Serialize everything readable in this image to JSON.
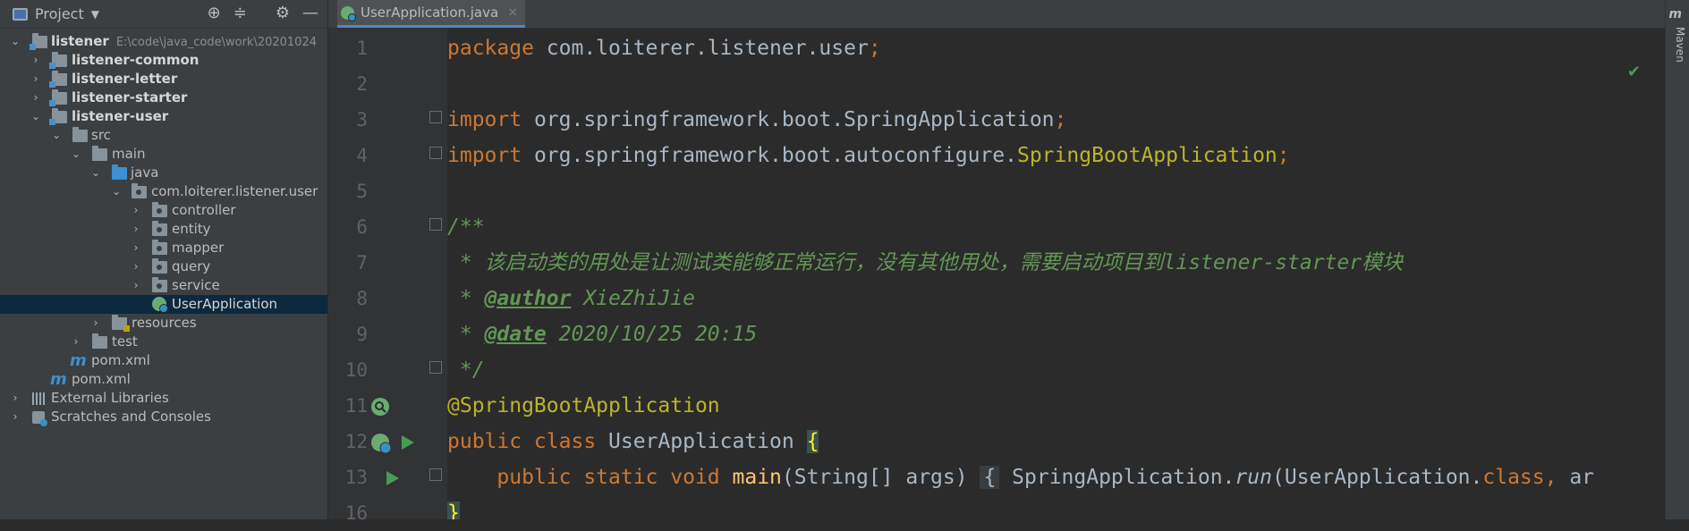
{
  "project_panel": {
    "title": "Project",
    "tree": [
      {
        "label": "listener",
        "path": "E:\\code\\java_code\\work\\20201024"
      },
      {
        "label": "listener-common"
      },
      {
        "label": "listener-letter"
      },
      {
        "label": "listener-starter"
      },
      {
        "label": "listener-user"
      },
      {
        "label": "src"
      },
      {
        "label": "main"
      },
      {
        "label": "java"
      },
      {
        "label": "com.loiterer.listener.user"
      },
      {
        "label": "controller"
      },
      {
        "label": "entity"
      },
      {
        "label": "mapper"
      },
      {
        "label": "query"
      },
      {
        "label": "service"
      },
      {
        "label": "UserApplication",
        "selected": true
      },
      {
        "label": "resources"
      },
      {
        "label": "test"
      },
      {
        "label": "pom.xml"
      },
      {
        "label": "pom.xml"
      },
      {
        "label": "External Libraries"
      },
      {
        "label": "Scratches and Consoles"
      }
    ]
  },
  "editor": {
    "tab_label": "UserApplication.java",
    "line_numbers": [
      "1",
      "2",
      "3",
      "4",
      "5",
      "6",
      "7",
      "8",
      "9",
      "10",
      "11",
      "12",
      "13",
      "16"
    ],
    "lines": {
      "l1_kw": "package",
      "l1_rest": " com.loiterer.listener.user",
      "l1_semi": ";",
      "l3_kw": "import",
      "l3_rest": " org.springframework.boot.SpringApplication",
      "l3_semi": ";",
      "l4_kw": "import",
      "l4_rest": " org.springframework.boot.autoconfigure.",
      "l4_ann": "SpringBootApplication",
      "l4_semi": ";",
      "l6": "/**",
      "l7": " * 该启动类的用处是让测试类能够正常运行，没有其他用处，需要启动项目到listener-starter模块",
      "l8_star": " * ",
      "l8_tag": "@author",
      "l8_val": " XieZhiJie",
      "l9_star": " * ",
      "l9_tag": "@date",
      "l9_val": " 2020/10/25 20:15",
      "l10": " */",
      "l11": "@SpringBootApplication",
      "l12_kw": "public class",
      "l12_name": " UserApplication ",
      "l12_brace": "{",
      "l13_indent": "    ",
      "l13_kw": "public static void",
      "l13_sp": " ",
      "l13_fn": "main",
      "l13_args": "(String[] args) ",
      "l13_fold": "{",
      "l13_call1": " SpringApplication.",
      "l13_run": "run",
      "l13_call2": "(UserApplication.",
      "l13_class": "class",
      "l13_comma": ", ",
      "l13_trail": "ar",
      "l16": "}"
    }
  },
  "right_toolbar": {
    "maven_label": "Maven",
    "maven_glyph": "m"
  },
  "icons": [
    "project-icon",
    "locate-icon",
    "collapse-icon",
    "gear-icon",
    "minimize-icon",
    "spring-class-icon",
    "close-icon",
    "run-icon",
    "check-icon"
  ]
}
